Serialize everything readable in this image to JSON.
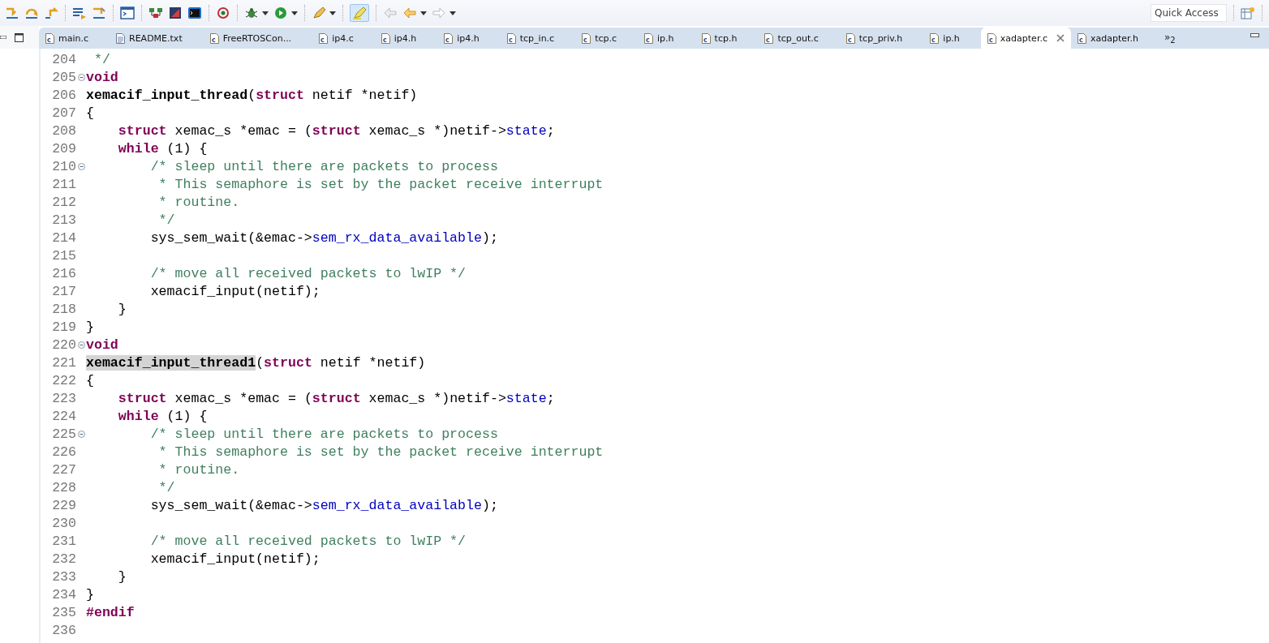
{
  "toolbar": {
    "quick_access": {
      "placeholder": "Quick Access"
    }
  },
  "tabs": [
    {
      "label": "main.c",
      "kind": "c",
      "selected": false
    },
    {
      "label": "README.txt",
      "kind": "text",
      "selected": false
    },
    {
      "label": "FreeRTOSCon...",
      "kind": "c",
      "selected": false
    },
    {
      "label": "ip4.c",
      "kind": "c",
      "selected": false
    },
    {
      "label": "ip4.h",
      "kind": "c",
      "selected": false
    },
    {
      "label": "ip4.h",
      "kind": "c",
      "selected": false
    },
    {
      "label": "tcp_in.c",
      "kind": "c",
      "selected": false
    },
    {
      "label": "tcp.c",
      "kind": "c",
      "selected": false
    },
    {
      "label": "ip.h",
      "kind": "c",
      "selected": false
    },
    {
      "label": "tcp.h",
      "kind": "c",
      "selected": false
    },
    {
      "label": "tcp_out.c",
      "kind": "c",
      "selected": false
    },
    {
      "label": "tcp_priv.h",
      "kind": "c",
      "selected": false
    },
    {
      "label": "ip.h",
      "kind": "c",
      "selected": false
    },
    {
      "label": "xadapter.c",
      "kind": "c",
      "selected": true
    },
    {
      "label": "xadapter.h",
      "kind": "c",
      "selected": false
    }
  ],
  "hidden_tabs": {
    "symbol": "»",
    "count": "2"
  },
  "editor": {
    "lines": [
      {
        "number": "204",
        "fold": false,
        "tokens": [
          {
            "kind": "comment",
            "text": " */"
          }
        ]
      },
      {
        "number": "205",
        "fold": true,
        "tokens": [
          {
            "kind": "keyword",
            "text": "void"
          }
        ]
      },
      {
        "number": "206",
        "fold": false,
        "tokens": [
          {
            "kind": "function",
            "text": "xemacif_input_thread",
            "highlighted": false
          },
          {
            "kind": "plain",
            "text": "("
          },
          {
            "kind": "keyword",
            "text": "struct"
          },
          {
            "kind": "plain",
            "text": " netif *netif)"
          }
        ]
      },
      {
        "number": "207",
        "fold": false,
        "tokens": [
          {
            "kind": "plain",
            "text": "{"
          }
        ]
      },
      {
        "number": "208",
        "fold": false,
        "tokens": [
          {
            "kind": "keyword",
            "text": "    struct"
          },
          {
            "kind": "plain",
            "text": " xemac_s *emac = ("
          },
          {
            "kind": "keyword",
            "text": "struct"
          },
          {
            "kind": "plain",
            "text": " xemac_s *)netif->"
          },
          {
            "kind": "field",
            "text": "state"
          },
          {
            "kind": "plain",
            "text": ";"
          }
        ]
      },
      {
        "number": "209",
        "fold": false,
        "tokens": [
          {
            "kind": "keyword",
            "text": "    while"
          },
          {
            "kind": "plain",
            "text": " (1) {"
          }
        ]
      },
      {
        "number": "210",
        "fold": true,
        "tokens": [
          {
            "kind": "comment",
            "text": "        /* sleep until there are packets to process"
          }
        ]
      },
      {
        "number": "211",
        "fold": false,
        "tokens": [
          {
            "kind": "comment",
            "text": "         * This semaphore is set by the packet receive interrupt"
          }
        ]
      },
      {
        "number": "212",
        "fold": false,
        "tokens": [
          {
            "kind": "comment",
            "text": "         * routine."
          }
        ]
      },
      {
        "number": "213",
        "fold": false,
        "tokens": [
          {
            "kind": "comment",
            "text": "         */"
          }
        ]
      },
      {
        "number": "214",
        "fold": false,
        "tokens": [
          {
            "kind": "plain",
            "text": "        sys_sem_wait(&emac->"
          },
          {
            "kind": "field",
            "text": "sem_rx_data_available"
          },
          {
            "kind": "plain",
            "text": ");"
          }
        ]
      },
      {
        "number": "215",
        "fold": false
      },
      {
        "number": "216",
        "fold": false,
        "tokens": [
          {
            "kind": "comment",
            "text": "        /* move all received packets to lwIP */"
          }
        ]
      },
      {
        "number": "217",
        "fold": false,
        "tokens": [
          {
            "kind": "plain",
            "text": "        xemacif_input(netif);"
          }
        ]
      },
      {
        "number": "218",
        "fold": false,
        "tokens": [
          {
            "kind": "plain",
            "text": "    }"
          }
        ]
      },
      {
        "number": "219",
        "fold": false,
        "tokens": [
          {
            "kind": "plain",
            "text": "}"
          }
        ]
      },
      {
        "number": "220",
        "fold": true,
        "tokens": [
          {
            "kind": "keyword",
            "text": "void"
          }
        ]
      },
      {
        "number": "221",
        "fold": false,
        "tokens": [
          {
            "kind": "function",
            "text": "xemacif_input_thread1",
            "highlighted": true
          },
          {
            "kind": "plain",
            "text": "("
          },
          {
            "kind": "keyword",
            "text": "struct"
          },
          {
            "kind": "plain",
            "text": " netif *netif)"
          }
        ]
      },
      {
        "number": "222",
        "fold": false,
        "tokens": [
          {
            "kind": "plain",
            "text": "{"
          }
        ]
      },
      {
        "number": "223",
        "fold": false,
        "tokens": [
          {
            "kind": "keyword",
            "text": "    struct"
          },
          {
            "kind": "plain",
            "text": " xemac_s *emac = ("
          },
          {
            "kind": "keyword",
            "text": "struct"
          },
          {
            "kind": "plain",
            "text": " xemac_s *)netif->"
          },
          {
            "kind": "field",
            "text": "state"
          },
          {
            "kind": "plain",
            "text": ";"
          }
        ]
      },
      {
        "number": "224",
        "fold": false,
        "tokens": [
          {
            "kind": "keyword",
            "text": "    while"
          },
          {
            "kind": "plain",
            "text": " (1) {"
          }
        ]
      },
      {
        "number": "225",
        "fold": true,
        "tokens": [
          {
            "kind": "comment",
            "text": "        /* sleep until there are packets to process"
          }
        ]
      },
      {
        "number": "226",
        "fold": false,
        "tokens": [
          {
            "kind": "comment",
            "text": "         * This semaphore is set by the packet receive interrupt"
          }
        ]
      },
      {
        "number": "227",
        "fold": false,
        "tokens": [
          {
            "kind": "comment",
            "text": "         * routine."
          }
        ]
      },
      {
        "number": "228",
        "fold": false,
        "tokens": [
          {
            "kind": "comment",
            "text": "         */"
          }
        ]
      },
      {
        "number": "229",
        "fold": false,
        "tokens": [
          {
            "kind": "plain",
            "text": "        sys_sem_wait(&emac->"
          },
          {
            "kind": "field",
            "text": "sem_rx_data_available"
          },
          {
            "kind": "plain",
            "text": ");"
          }
        ]
      },
      {
        "number": "230",
        "fold": false
      },
      {
        "number": "231",
        "fold": false,
        "tokens": [
          {
            "kind": "comment",
            "text": "        /* move all received packets to lwIP */"
          }
        ]
      },
      {
        "number": "232",
        "fold": false,
        "tokens": [
          {
            "kind": "plain",
            "text": "        xemacif_input(netif);"
          }
        ]
      },
      {
        "number": "233",
        "fold": false,
        "tokens": [
          {
            "kind": "plain",
            "text": "    }"
          }
        ]
      },
      {
        "number": "234",
        "fold": false,
        "tokens": [
          {
            "kind": "plain",
            "text": "}"
          }
        ]
      },
      {
        "number": "235",
        "fold": false,
        "tokens": [
          {
            "kind": "keyword",
            "text": "#endif"
          }
        ]
      },
      {
        "number": "236",
        "fold": false
      }
    ]
  }
}
